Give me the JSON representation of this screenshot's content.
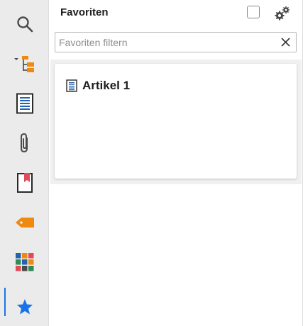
{
  "panel": {
    "title": "Favoriten",
    "filter": {
      "placeholder": "Favoriten filtern",
      "value": ""
    }
  },
  "sidebar": {
    "items": [
      {
        "icon": "search-icon",
        "active": false
      },
      {
        "icon": "tree-structure-icon",
        "active": false
      },
      {
        "icon": "document-icon",
        "active": false
      },
      {
        "icon": "paperclip-icon",
        "active": false
      },
      {
        "icon": "bookmark-icon",
        "active": false
      },
      {
        "icon": "tag-icon",
        "active": false
      },
      {
        "icon": "tiles-icon",
        "active": false
      },
      {
        "icon": "star-icon",
        "active": true
      }
    ]
  },
  "favorites": [
    {
      "label": "Artikel 1",
      "icon": "document-icon"
    }
  ],
  "colors": {
    "accent": "#1a73e8",
    "orange": "#f0890f",
    "red": "#e14b57",
    "blue_doc": "#2563ad"
  }
}
